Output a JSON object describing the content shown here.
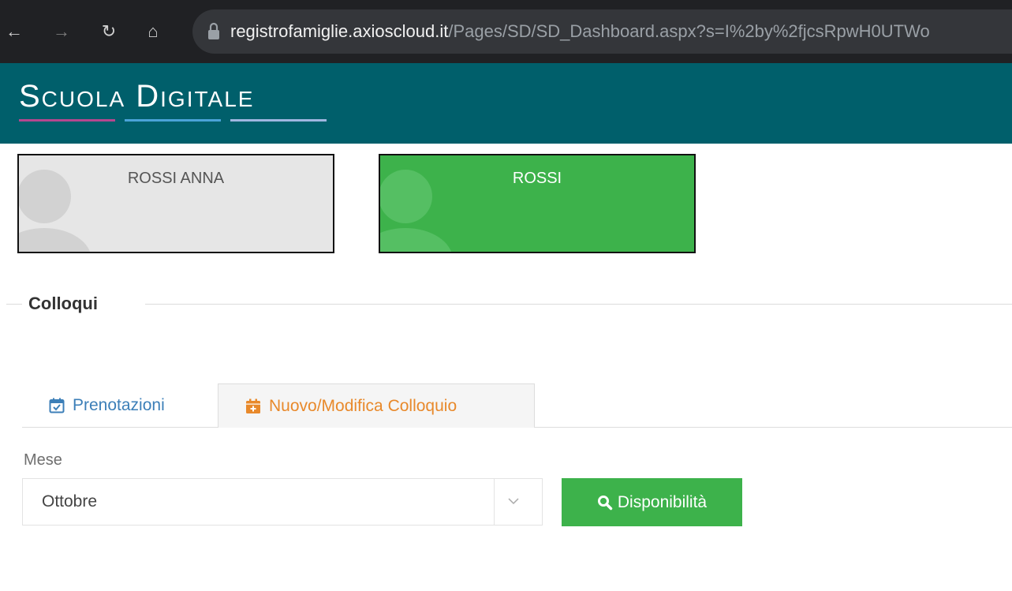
{
  "browser": {
    "url_domain": "registrofamiglie.axioscloud.it",
    "url_path": "/Pages/SD/SD_Dashboard.aspx?s=I%2by%2fjcsRpwH0UTWo",
    "icons": [
      "back-arrow-icon",
      "forward-arrow-icon",
      "reload-icon",
      "home-icon",
      "lock-icon"
    ]
  },
  "header": {
    "logo": "Scuola Digitale",
    "colors": {
      "background": "#005f6b",
      "line1": "#b5478f",
      "line2": "#4aa3d8",
      "line3": "#9fb6e0"
    }
  },
  "students": [
    {
      "name": "ROSSI ANNA",
      "selected": false
    },
    {
      "name": "ROSSI",
      "selected": true
    }
  ],
  "section": {
    "title": "Colloqui"
  },
  "tabs": [
    {
      "label": "Prenotazioni",
      "icon": "calendar-check-icon",
      "active": false
    },
    {
      "label": "Nuovo/Modifica Colloquio",
      "icon": "calendar-plus-icon",
      "active": true
    }
  ],
  "form": {
    "month_label": "Mese",
    "month_value": "Ottobre",
    "availability_button": "Disponibilità",
    "button_icon": "search-icon"
  },
  "colors": {
    "accent_green": "#3db24b",
    "tab_active": "#e8892b",
    "tab_link": "#3c7fb8"
  }
}
